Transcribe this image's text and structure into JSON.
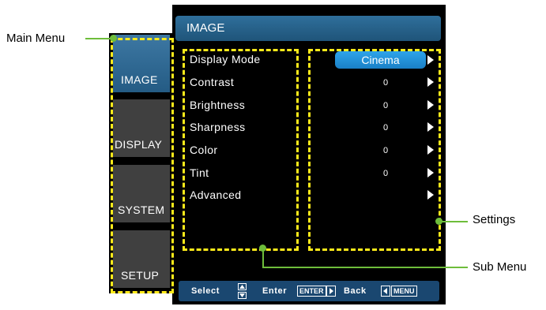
{
  "title": "IMAGE",
  "main_menu": [
    {
      "label": "IMAGE",
      "active": true
    },
    {
      "label": "DISPLAY",
      "active": false
    },
    {
      "label": "SYSTEM",
      "active": false
    },
    {
      "label": "SETUP",
      "active": false
    }
  ],
  "sub_menu": [
    {
      "label": "Display Mode",
      "value": "Cinema"
    },
    {
      "label": "Contrast",
      "value": "0"
    },
    {
      "label": "Brightness",
      "value": "0"
    },
    {
      "label": "Sharpness",
      "value": "0"
    },
    {
      "label": "Color",
      "value": "0"
    },
    {
      "label": "Tint",
      "value": "0"
    },
    {
      "label": "Advanced",
      "value": ""
    }
  ],
  "hint_bar": {
    "select": "Select",
    "enter": "Enter",
    "enter_key": "ENTER",
    "back": "Back",
    "menu_key": "MENU"
  },
  "callouts": {
    "main_menu": "Main Menu",
    "settings": "Settings",
    "sub_menu": "Sub Menu"
  },
  "colors": {
    "highlight": "#ffeb1a",
    "callout_line": "#6ebd3b",
    "title_bar": "#2f6f9b",
    "selected_value": "#2ea4ea"
  }
}
